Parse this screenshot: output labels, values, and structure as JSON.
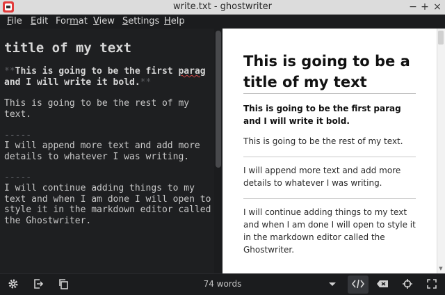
{
  "window": {
    "title": "write.txt - ghostwriter",
    "minimize_glyph": "−",
    "maximize_glyph": "+",
    "close_glyph": "×"
  },
  "menu": {
    "items": [
      {
        "label_ul": "F",
        "label_rest": "ile"
      },
      {
        "label_ul": "E",
        "label_rest": "dit"
      },
      {
        "label_pre": "For",
        "label_ul": "m",
        "label_rest": "at"
      },
      {
        "label_ul": "V",
        "label_rest": "iew"
      },
      {
        "label_ul": "S",
        "label_rest": "ettings"
      },
      {
        "label_ul": "H",
        "label_rest": "elp"
      }
    ]
  },
  "editor": {
    "heading": "title of my text",
    "bold_open_marker": "**",
    "bold_line1": "This is going to be the first ",
    "bold_line1_misspelled": "parag",
    "bold_line2": "and I will write it bold.",
    "bold_close_marker": "**",
    "para1": "This is going to be the rest of my\ntext.",
    "rule1": "-----",
    "para2": "I will append more text and add more\ndetails to whatever I was writing.",
    "rule2": "-----",
    "para3": "I will continue adding things to my\ntext and when I am done I will open to\nstyle it in the markdown editor called\nthe Ghostwriter."
  },
  "preview": {
    "heading": "This is going to be a title of my text",
    "bold_paragraph": "This is going to be the first parag and I will write it bold.",
    "paragraph1": "This is going to be the rest of my text.",
    "paragraph2": "I will append more text and add more details to whatever I was writing.",
    "paragraph3": "I will continue adding things to my text and when I am done I will open to style it in the markdown editor called the Ghostwriter."
  },
  "statusbar": {
    "word_count": "74 words",
    "icons": [
      "settings-icon",
      "export-icon",
      "copy-icon",
      "dropdown-arrow-icon",
      "html-preview-icon",
      "hemingway-mode-icon",
      "focus-mode-icon",
      "fullscreen-icon"
    ]
  },
  "colors": {
    "editor_bg": "#1e1f21",
    "preview_bg": "#ffffff",
    "app_icon": "#e23b3b"
  }
}
